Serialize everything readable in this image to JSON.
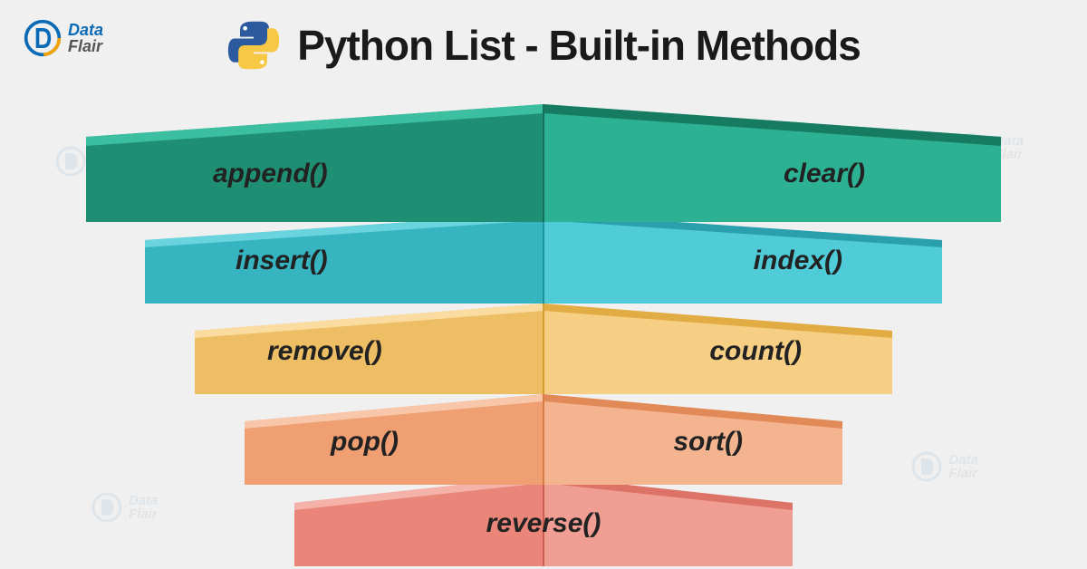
{
  "brand": {
    "line1": "Data",
    "line2": "Flair"
  },
  "title": "Python List - Built-in Methods",
  "rows": [
    {
      "left": "append()",
      "right": "clear()"
    },
    {
      "left": "insert()",
      "right": "index()"
    },
    {
      "left": "remove()",
      "right": "count()"
    },
    {
      "left": "pop()",
      "right": "sort()"
    },
    {
      "center": "reverse()"
    }
  ],
  "colors": {
    "r1": {
      "leftTop": "#2ca88a",
      "leftFace": "#1f8f73",
      "rightTop": "#1f9a7d",
      "rightFace": "#2db193",
      "seam": "#147059"
    },
    "r2": {
      "leftTop": "#4cc8d3",
      "leftFace": "#36b5c1",
      "rightTop": "#35b5c1",
      "rightFace": "#4fccd8",
      "seam": "#1f94a0"
    },
    "r3": {
      "leftTop": "#f7cf84",
      "leftFace": "#edbe63",
      "rightTop": "#edbe63",
      "rightFace": "#f7cf84",
      "seam": "#d49e34"
    },
    "r4": {
      "leftTop": "#f5b490",
      "leftFace": "#ef9f72",
      "rightTop": "#ef9f72",
      "rightFace": "#f5b490",
      "seam": "#d97c46"
    },
    "r5": {
      "leftTop": "#f09d93",
      "leftFace": "#e98579",
      "rightTop": "#e98579",
      "rightFace": "#f09d93",
      "seam": "#cf5d50"
    }
  }
}
